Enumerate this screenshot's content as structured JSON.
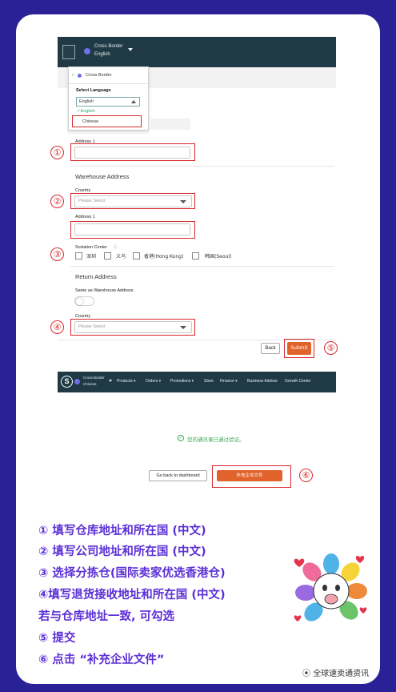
{
  "screen1": {
    "nav": {
      "account_name": "Cross Border",
      "account_language": "English"
    },
    "dropdown": {
      "account_option": "Cross Border",
      "select_language_label": "Select Language",
      "select_value": "English",
      "options": [
        "English",
        "Chinese"
      ],
      "checkmark": "✓"
    },
    "form": {
      "address1_label": "Address 1",
      "warehouse_header": "Warehouse Address",
      "country_label": "Country",
      "country_placeholder": "Please Select",
      "address1_label_2": "Address 1",
      "sortation_label": "Sortation Center",
      "sortation_options": [
        "深圳",
        "义乌",
        "香港(Hong Kong)",
        "韩国(Seoul)"
      ],
      "return_header": "Return Address",
      "same_as_label": "Same as Warehouse Address",
      "return_country_label": "Country",
      "return_country_placeholder": "Please Select",
      "back_button": "Back",
      "submit_button": "Submit"
    }
  },
  "screen2": {
    "nav": {
      "logo_letter": "S",
      "account_name": "Cross Border",
      "account_language": "Chinese",
      "menu": [
        "Products ▾",
        "Orders ▾",
        "Promotions ▾",
        "Store",
        "Finance ▾",
        "Business Advisor",
        "Growth Center"
      ]
    },
    "success_message": "您的通讯录已通过验证。",
    "dashboard_button": "Go back to dashboard",
    "supplement_button": "补充企业文件"
  },
  "markers": [
    "①",
    "②",
    "③",
    "④",
    "⑤",
    "⑥"
  ],
  "instructions": [
    "① 填写仓库地址和所在国 (中文)",
    "② 填写公司地址和所在国 (中文)",
    "③ 选择分拣仓(国际卖家优选香港仓)",
    "④填写退货接收地址和所在国 (中文)",
    "若与仓库地址一致, 可勾选",
    "⑤ 提交",
    "⑥ 点击 “补充企业文件”"
  ],
  "watermark": "全球速卖通资讯",
  "colors": {
    "background": "#2a2196",
    "nav": "#1f3a45",
    "accent": "#e0632b",
    "marker_red": "#d9282c",
    "instruction_text": "#5b2fd6"
  }
}
